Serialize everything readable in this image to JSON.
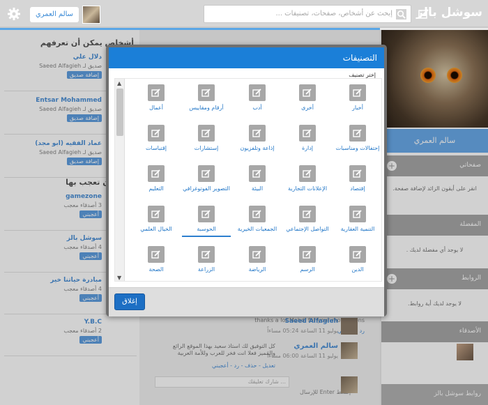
{
  "brand": {
    "logo": "سوشل بالز"
  },
  "header": {
    "search_placeholder": "إبحث عن أشخاص، صفحات، تصنيفات ...",
    "user_name": "سالم العمري"
  },
  "left": {
    "people_title": "أشخاص يمكن أن تعرفهم",
    "people": [
      {
        "name": "دلال علي",
        "sub": "صديق لـ Saeed Alfagieh",
        "add": "إضافة صديق"
      },
      {
        "name": "Entsar Mohammed",
        "sub": "صديق لـ Saeed Alfagieh",
        "add": "إضافة صديق"
      },
      {
        "name": "عماد الفقيه (ابو مجد)",
        "sub": "صديق لـ Saeed Alfagieh",
        "add": "إضافة صديق"
      }
    ],
    "pages_title": "يمكن أن تعجب بها",
    "pages": [
      {
        "name": "gamezone",
        "sub": "3 أصدقاء معجب",
        "add": "أعجبني"
      },
      {
        "name": "سوشل بالز",
        "sub": "4 أصدقاء معجب",
        "add": "أعجبني"
      },
      {
        "name": "مبادرة حياتنا خير",
        "sub": "4 أصدقاء معجب",
        "add": "أعجبني"
      },
      {
        "name": "Y.B.C",
        "sub": "2 أصدقاء معجب",
        "add": "أعجبني"
      }
    ]
  },
  "right": {
    "profile_name": "سالم العمري",
    "pages_label": "صفحاتي",
    "pages_text": "انقر على أيقون الزائد لإضافة صفحة.",
    "fav_label": "المفضلة",
    "fav_text": "لا يوجد أي مفضلة لديك .",
    "links_label": "الروابط",
    "links_text": "لا يوجد لديك أية روابط.",
    "friends_label": "الأصدقاء",
    "footer_label": "روابط سوشل بالز"
  },
  "feed": {
    "comment1_text": "thanks a lot Mohdi for your motivations",
    "comment1_meta": "رد - أعجبني",
    "post1_author": "Saeed Alfagieh",
    "post1_date": "يوليو 11 الساعة 05:24 مساءاً",
    "post2_author": "سالم العمري",
    "post2_date": "يوليو 11 الساعة 06:00 مساءاً",
    "post2_text": "كل التوفيق لك استاذ سعيد بهذا الموقع الرائع والمميز فعلا انت فخر للعرب وللأمة العربية",
    "post2_meta": "تعديل - حذف - رد - أعجبني",
    "comment_placeholder": "شارك تعليقك ...",
    "enter_hint": "إضغط Enter للإرسال"
  },
  "modal": {
    "title": "التصنيفات",
    "choose_label": "إختر تصنيف",
    "close_label": "إغلاق",
    "categories": [
      "أخبار",
      "أخرى",
      "أدب",
      "أرقام ومقاييس",
      "أعمال",
      "إحتفالات ومناسبات",
      "إدارة",
      "إذاعة وتلفزيون",
      "إستشارات",
      "إقتباسات",
      "إقتصاد",
      "الإعلانات التجارية",
      "البيئة",
      "التصوير الفوتوغرافي",
      "التعليم",
      "التنمية العقارية",
      "التواصل الإجتماعي",
      "الجمعيات الخيرية",
      "الحوسبة",
      "الخيال العلمي",
      "الدين",
      "الرسم",
      "الرياضة",
      "الزراعة",
      "الصحة"
    ]
  }
}
